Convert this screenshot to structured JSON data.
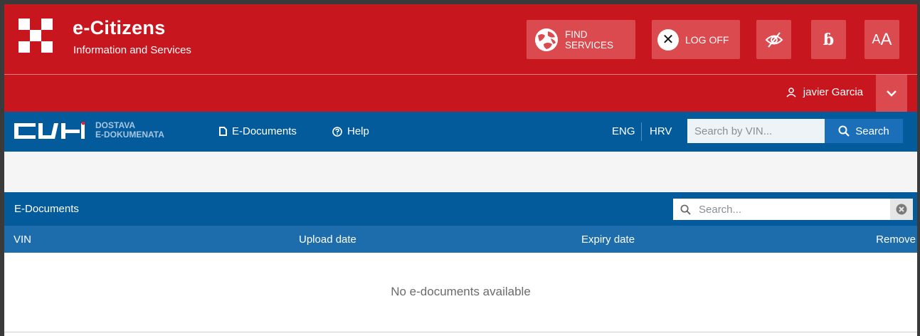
{
  "header": {
    "title": "e-Citizens",
    "subtitle": "Information and Services",
    "find_services_label": "FIND\nSERVICES",
    "logoff_label": "LOG OFF",
    "dyslexia_label": "ɓ",
    "font_size_label_small": "A",
    "font_size_label_large": "A",
    "colors": {
      "red": "#c8161e",
      "button": "#da4a4f"
    }
  },
  "user": {
    "name": "javier Garcia"
  },
  "nav": {
    "logo_line1": "DOSTAVA",
    "logo_line2": "E-DOKUMENATA",
    "documents_label": "E-Documents",
    "help_label": "Help",
    "lang_eng": "ENG",
    "lang_hrv": "HRV",
    "vin_placeholder": "Search by VIN...",
    "search_label": "Search",
    "colors": {
      "blue": "#035b9b"
    }
  },
  "panel": {
    "title": "E-Documents",
    "search_placeholder": "Search...",
    "columns": [
      "VIN",
      "Upload date",
      "Expiry date",
      "Remove"
    ],
    "empty_message": "No e-documents available"
  }
}
